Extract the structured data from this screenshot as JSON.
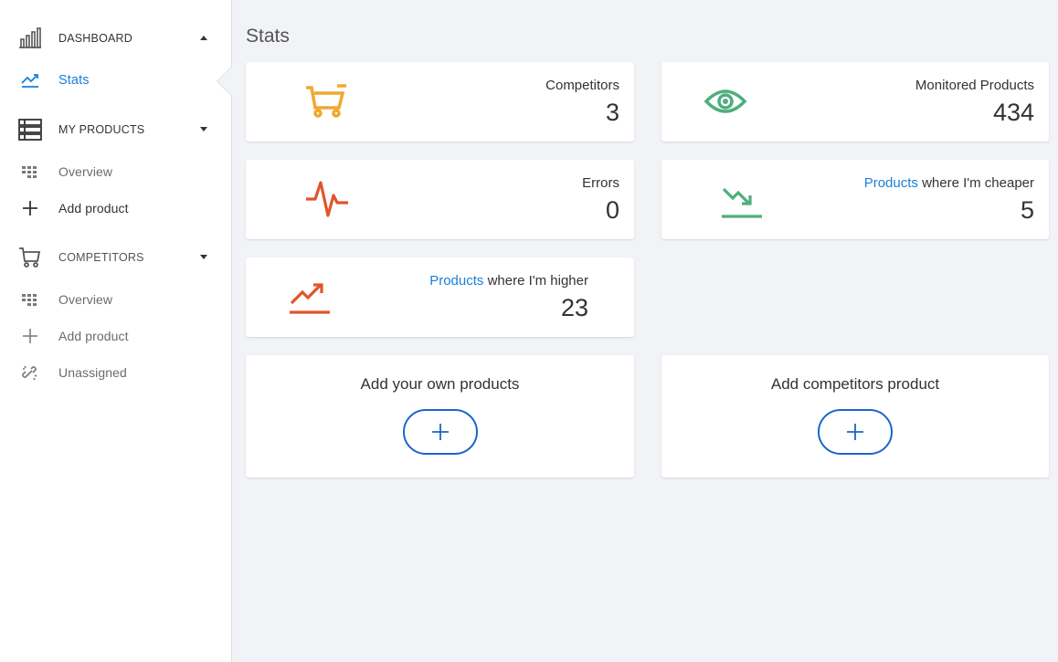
{
  "sidebar": {
    "dashboard": {
      "label": "DASHBOARD",
      "icon": "bar-chart-icon"
    },
    "stats": {
      "label": "Stats",
      "icon": "trend-up-icon"
    },
    "my_products": {
      "label": "MY PRODUCTS",
      "icon": "list-icon"
    },
    "my_products_overview": {
      "label": "Overview",
      "icon": "grid-dots-icon"
    },
    "my_products_add": {
      "label": "Add product",
      "icon": "plus-icon"
    },
    "competitors": {
      "label": "COMPETITORS",
      "icon": "cart-icon"
    },
    "competitors_overview": {
      "label": "Overview",
      "icon": "grid-dots-icon"
    },
    "competitors_add": {
      "label": "Add product",
      "icon": "plus-icon"
    },
    "unassigned": {
      "label": "Unassigned",
      "icon": "unlink-icon"
    }
  },
  "main": {
    "title": "Stats",
    "stats": {
      "competitors": {
        "title": "Competitors",
        "value": "3",
        "icon": "cart-icon",
        "color": "#f0a830"
      },
      "monitored": {
        "title": "Monitored Products",
        "value": "434",
        "icon": "eye-icon",
        "color": "#4fae7c"
      },
      "errors": {
        "title": "Errors",
        "value": "0",
        "icon": "pulse-icon",
        "color": "#e0552b"
      },
      "cheaper": {
        "link": "Products",
        "title": " where I'm cheaper",
        "value": "5",
        "icon": "trend-down-icon",
        "color": "#4fae7c"
      },
      "higher": {
        "link": "Products",
        "title": " where I'm higher",
        "value": "23",
        "icon": "trend-up-icon",
        "color": "#e0552b"
      }
    },
    "actions": {
      "own": {
        "heading": "Add your own products"
      },
      "competitor": {
        "heading": "Add competitors product"
      }
    }
  },
  "colors": {
    "accent": "#1a7fd8",
    "background": "#f2f3f7"
  }
}
